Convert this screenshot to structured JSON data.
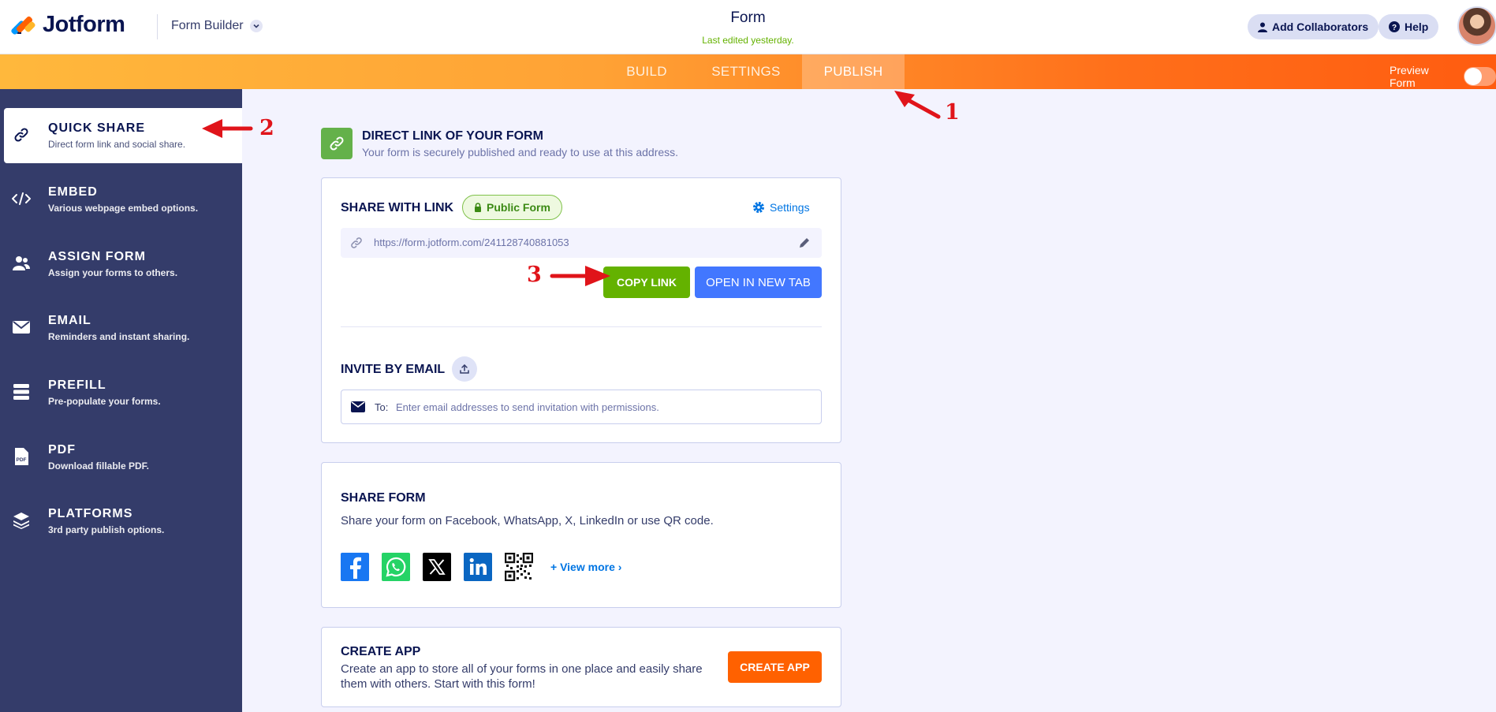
{
  "header": {
    "brand": "Jotform",
    "builder_label": "Form Builder",
    "form_title": "Form",
    "last_edited": "Last edited yesterday.",
    "collaborators_label": "Add Collaborators",
    "help_label": "Help"
  },
  "nav": {
    "tabs": [
      {
        "label": "BUILD",
        "active": false
      },
      {
        "label": "SETTINGS",
        "active": false
      },
      {
        "label": "PUBLISH",
        "active": true
      }
    ],
    "preview_label": "Preview Form"
  },
  "sidebar": {
    "items": [
      {
        "title": "QUICK SHARE",
        "desc": "Direct form link and social share.",
        "icon": "link-icon",
        "active": true
      },
      {
        "title": "EMBED",
        "desc": "Various webpage embed options.",
        "icon": "code-icon",
        "active": false
      },
      {
        "title": "ASSIGN FORM",
        "desc": "Assign your forms to others.",
        "icon": "users-icon",
        "active": false
      },
      {
        "title": "EMAIL",
        "desc": "Reminders and instant sharing.",
        "icon": "envelope-icon",
        "active": false
      },
      {
        "title": "PREFILL",
        "desc": "Pre-populate your forms.",
        "icon": "prefill-icon",
        "active": false
      },
      {
        "title": "PDF",
        "desc": "Download fillable PDF.",
        "icon": "pdf-icon",
        "active": false
      },
      {
        "title": "PLATFORMS",
        "desc": "3rd party publish options.",
        "icon": "layers-icon",
        "active": false
      }
    ]
  },
  "direct_link": {
    "title": "DIRECT LINK OF YOUR FORM",
    "subtitle": "Your form is securely published and ready to use at this address."
  },
  "share_link": {
    "label": "SHARE WITH LINK",
    "badge": "Public Form",
    "settings_label": "Settings",
    "url": "https://form.jotform.com/241128740881053",
    "copy_label": "COPY LINK",
    "open_label": "OPEN IN NEW TAB"
  },
  "invite": {
    "label": "INVITE BY EMAIL",
    "to_label": "To:",
    "placeholder": "Enter email addresses to send invitation with permissions."
  },
  "share_form": {
    "title": "SHARE FORM",
    "desc": "Share your form on Facebook, WhatsApp, X, LinkedIn or use QR code.",
    "socials": [
      "facebook-icon",
      "whatsapp-icon",
      "x-icon",
      "linkedin-icon",
      "qr-code-icon"
    ],
    "view_more": "View more"
  },
  "create_app": {
    "title": "CREATE APP",
    "desc": "Create an app to store all of your forms in one place and easily share them with others. Start with this form!",
    "button": "CREATE APP"
  },
  "annotations": [
    "1",
    "2",
    "3"
  ],
  "colors": {
    "accent_orange": "#ff6100",
    "sidebar_bg": "#343c6a",
    "copy_green": "#64b200",
    "open_blue": "#4277ff",
    "annotation_red": "#e0141a"
  }
}
